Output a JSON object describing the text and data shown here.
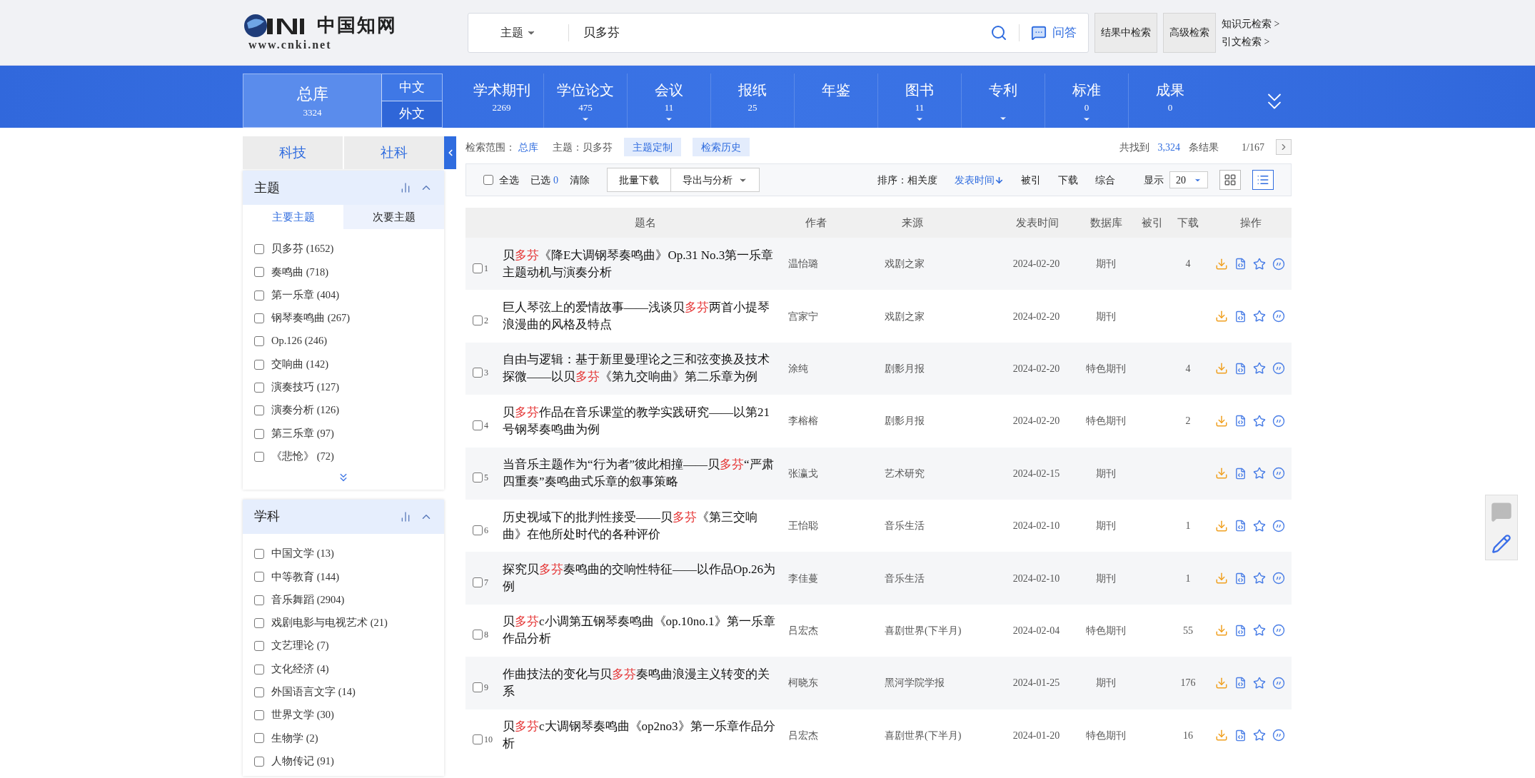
{
  "header": {
    "logo_text": "www.cnki.net",
    "logo_title": "中国知网",
    "search": {
      "field": "主题",
      "value": "贝多芬",
      "qa": "问答"
    },
    "buttons": [
      "结果中检索",
      "高级检索"
    ],
    "links": [
      "知识元检索 >",
      "引文检索 >"
    ]
  },
  "db_bar": {
    "main": {
      "label": "总库",
      "count": "3324"
    },
    "lang_tabs": [
      {
        "label": "中文",
        "selected": true
      },
      {
        "label": "外文",
        "selected": false
      }
    ],
    "items": [
      {
        "label": "学术期刊",
        "count": "2269",
        "dropdown": false
      },
      {
        "label": "学位论文",
        "count": "475",
        "dropdown": true
      },
      {
        "label": "会议",
        "count": "11",
        "dropdown": true
      },
      {
        "label": "报纸",
        "count": "25",
        "dropdown": false
      },
      {
        "label": "年鉴",
        "dropdown": false
      },
      {
        "label": "图书",
        "count": "11",
        "dropdown": true
      },
      {
        "label": "专利",
        "dropdown": true
      },
      {
        "label": "标准",
        "count": "0",
        "dropdown": true
      },
      {
        "label": "成果",
        "count": "0",
        "dropdown": false
      }
    ]
  },
  "sidebar": {
    "tabs": [
      "科技",
      "社科"
    ],
    "facets": [
      {
        "title": "主题",
        "subtabs": [
          {
            "label": "主要主题",
            "selected": true
          },
          {
            "label": "次要主题",
            "selected": false
          }
        ],
        "more": true,
        "items": [
          {
            "label": "贝多芬 (1652)",
            "checked": false
          },
          {
            "label": "奏鸣曲 (718)",
            "checked": false
          },
          {
            "label": "第一乐章 (404)",
            "checked": false
          },
          {
            "label": "钢琴奏鸣曲 (267)",
            "checked": false
          },
          {
            "label": "Op.126 (246)",
            "checked": false
          },
          {
            "label": "交响曲 (142)",
            "checked": false
          },
          {
            "label": "演奏技巧 (127)",
            "checked": false
          },
          {
            "label": "演奏分析 (126)",
            "checked": false
          },
          {
            "label": "第三乐章 (97)",
            "checked": false
          },
          {
            "label": "《悲怆》 (72)",
            "checked": false
          }
        ]
      },
      {
        "title": "学科",
        "more": false,
        "items": [
          {
            "label": "中国文学 (13)",
            "checked": false
          },
          {
            "label": "中等教育 (144)",
            "checked": false
          },
          {
            "label": "音乐舞蹈 (2904)",
            "checked": false
          },
          {
            "label": "戏剧电影与电视艺术 (21)",
            "checked": false
          },
          {
            "label": "文艺理论 (7)",
            "checked": false
          },
          {
            "label": "文化经济 (4)",
            "checked": false
          },
          {
            "label": "外国语言文字 (14)",
            "checked": false
          },
          {
            "label": "世界文学 (30)",
            "checked": false
          },
          {
            "label": "生物学 (2)",
            "checked": false
          },
          {
            "label": "人物传记 (91)",
            "checked": false
          }
        ]
      }
    ]
  },
  "scope": {
    "label": "检索范围：",
    "value": "总库",
    "topic": "主题：贝多芬",
    "buttons": [
      "主题定制",
      "检索历史"
    ],
    "found_prefix": "共找到",
    "found_count": "3,324",
    "found_suffix": "条结果",
    "page": "1/167"
  },
  "toolbar": {
    "select_all": {
      "label": "全选",
      "checked": false
    },
    "selected_label": "已选",
    "selected_count": "0",
    "clear": "清除",
    "buttons": [
      "批量下载",
      "导出与分析"
    ],
    "sort_label": "排序：",
    "sort": [
      {
        "label": "相关度",
        "selected": false
      },
      {
        "label": "发表时间",
        "selected": true
      },
      {
        "label": "被引",
        "selected": false
      },
      {
        "label": "下载",
        "selected": false
      },
      {
        "label": "综合",
        "selected": false
      }
    ],
    "page_size_label": "显示",
    "page_size": "20",
    "views": [
      {
        "kind": "grid",
        "selected": false
      },
      {
        "kind": "list",
        "selected": true
      }
    ]
  },
  "table": {
    "columns": [
      "题名",
      "作者",
      "来源",
      "发表时间",
      "数据库",
      "被引",
      "下载",
      "操作"
    ],
    "rows": [
      {
        "num": "1",
        "checked": false,
        "title": [
          {
            "text": "贝"
          },
          {
            "text": "多芬",
            "hl": true
          },
          {
            "text": "《降E大调钢琴奏鸣曲》Op.31 No.3第一乐章主题动机与演奏分析"
          }
        ],
        "author": "温怡璐",
        "source": "戏剧之家",
        "date": "2024-02-20",
        "db": "期刊",
        "downloads": "4"
      },
      {
        "num": "2",
        "checked": false,
        "title": [
          {
            "text": "巨人琴弦上的爱情故事——浅谈贝"
          },
          {
            "text": "多芬",
            "hl": true
          },
          {
            "text": "两首小提琴浪漫曲的风格及特点"
          }
        ],
        "author": "宫家宁",
        "source": "戏剧之家",
        "date": "2024-02-20",
        "db": "期刊"
      },
      {
        "num": "3",
        "checked": false,
        "title": [
          {
            "text": "自由与逻辑：基于新里曼理论之三和弦变换及技术探微——以贝"
          },
          {
            "text": "多芬",
            "hl": true
          },
          {
            "text": "《第九交响曲》第二乐章为例"
          }
        ],
        "author": "涂纯",
        "source": "剧影月报",
        "date": "2024-02-20",
        "db": "特色期刊",
        "downloads": "4"
      },
      {
        "num": "4",
        "checked": false,
        "title": [
          {
            "text": "贝"
          },
          {
            "text": "多芬",
            "hl": true
          },
          {
            "text": "作品在音乐课堂的教学实践研究——以第21号钢琴奏鸣曲为例"
          }
        ],
        "author": "李榕榕",
        "source": "剧影月报",
        "date": "2024-02-20",
        "db": "特色期刊",
        "downloads": "2"
      },
      {
        "num": "5",
        "checked": false,
        "title": [
          {
            "text": "当音乐主题作为“行为者”彼此相撞——贝"
          },
          {
            "text": "多芬",
            "hl": true
          },
          {
            "text": "“严肃四重奏”奏鸣曲式乐章的叙事策略"
          }
        ],
        "author": "张瀛戈",
        "source": "艺术研究",
        "date": "2024-02-15",
        "db": "期刊"
      },
      {
        "num": "6",
        "checked": false,
        "title": [
          {
            "text": "历史视域下的批判性接受——贝"
          },
          {
            "text": "多芬",
            "hl": true
          },
          {
            "text": "《第三交响曲》在他所处时代的各种评价"
          }
        ],
        "author": "王怡聪",
        "source": "音乐生活",
        "date": "2024-02-10",
        "db": "期刊",
        "downloads": "1"
      },
      {
        "num": "7",
        "checked": false,
        "title": [
          {
            "text": "探究贝"
          },
          {
            "text": "多芬",
            "hl": true
          },
          {
            "text": "奏鸣曲的交响性特征——以作品Op.26为例"
          }
        ],
        "author": "李佳蔓",
        "source": "音乐生活",
        "date": "2024-02-10",
        "db": "期刊",
        "downloads": "1"
      },
      {
        "num": "8",
        "checked": false,
        "title": [
          {
            "text": "贝"
          },
          {
            "text": "多芬",
            "hl": true
          },
          {
            "text": "c小调第五钢琴奏鸣曲《op.10no.1》第一乐章作品分析"
          }
        ],
        "author": "吕宏杰",
        "source": "喜剧世界(下半月)",
        "date": "2024-02-04",
        "db": "特色期刊",
        "downloads": "55"
      },
      {
        "num": "9",
        "checked": false,
        "title": [
          {
            "text": "作曲技法的变化与贝"
          },
          {
            "text": "多芬",
            "hl": true
          },
          {
            "text": "奏鸣曲浪漫主义转变的关系"
          }
        ],
        "author": "柯晓东",
        "source": "黑河学院学报",
        "date": "2024-01-25",
        "db": "期刊",
        "downloads": "176"
      },
      {
        "num": "10",
        "checked": false,
        "title": [
          {
            "text": "贝"
          },
          {
            "text": "多芬",
            "hl": true
          },
          {
            "text": "c大调钢琴奏鸣曲《op2no3》第一乐章作品分析"
          }
        ],
        "author": "吕宏杰",
        "source": "喜剧世界(下半月)",
        "date": "2024-01-20",
        "db": "特色期刊",
        "downloads": "16"
      }
    ]
  }
}
